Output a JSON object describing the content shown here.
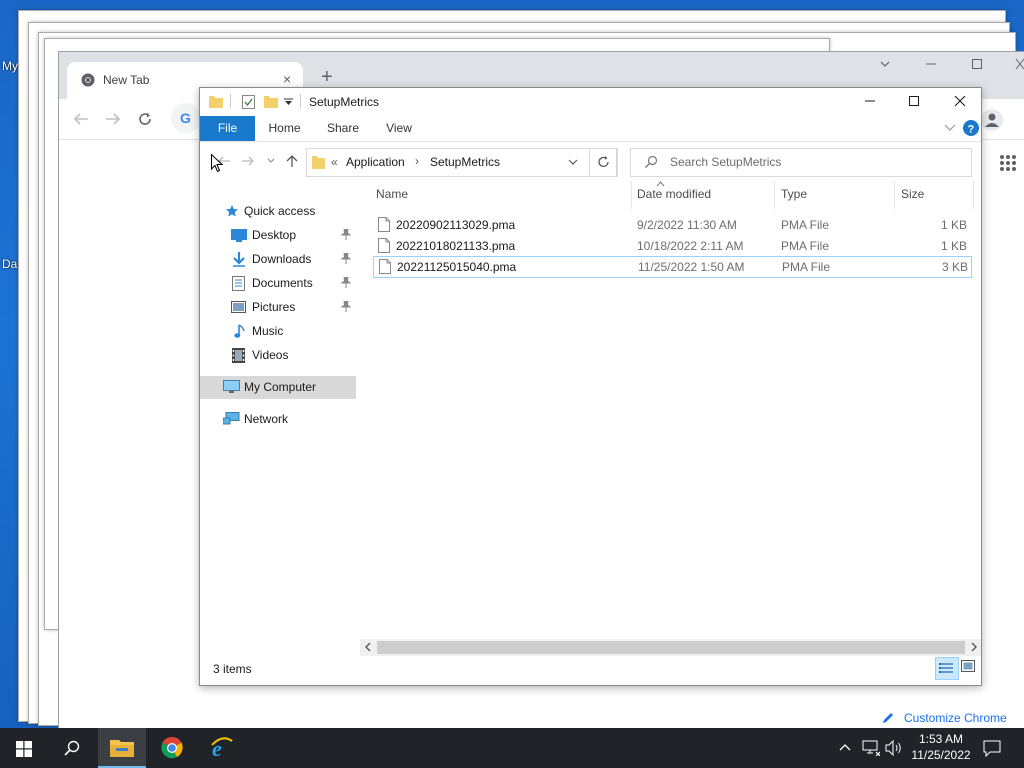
{
  "desktop": {
    "label_top": "My",
    "label_bottom": "Da"
  },
  "chrome": {
    "tab_title": "New Tab",
    "tab_close_symbol": "×",
    "new_tab_symbol": "+",
    "customize_label": "Customize Chrome"
  },
  "explorer": {
    "title": "SetupMetrics",
    "ribbon_tabs": [
      "File",
      "Home",
      "Share",
      "View"
    ],
    "breadcrumb": {
      "prefix": "«",
      "items": [
        "Application",
        "SetupMetrics"
      ],
      "separator": "›"
    },
    "search_placeholder": "Search SetupMetrics",
    "nav": {
      "quick_access": "Quick access",
      "items": [
        "Desktop",
        "Downloads",
        "Documents",
        "Pictures",
        "Music",
        "Videos"
      ],
      "pinned_count": 4,
      "my_computer": "My Computer",
      "network": "Network"
    },
    "columns": [
      "Name",
      "Date modified",
      "Type",
      "Size"
    ],
    "files": [
      {
        "name": "20220902113029.pma",
        "date": "9/2/2022 11:30 AM",
        "type": "PMA File",
        "size": "1 KB"
      },
      {
        "name": "20221018021133.pma",
        "date": "10/18/2022 2:11 AM",
        "type": "PMA File",
        "size": "1 KB"
      },
      {
        "name": "20221125015040.pma",
        "date": "11/25/2022 1:50 AM",
        "type": "PMA File",
        "size": "3 KB"
      }
    ],
    "status": "3 items"
  },
  "taskbar": {
    "time": "1:53 AM",
    "date": "11/25/2022"
  },
  "colors": {
    "accent": "#1979ca",
    "desktop": "#1c6fcf",
    "taskbar": "#202428",
    "selection": "#cce8ff"
  }
}
